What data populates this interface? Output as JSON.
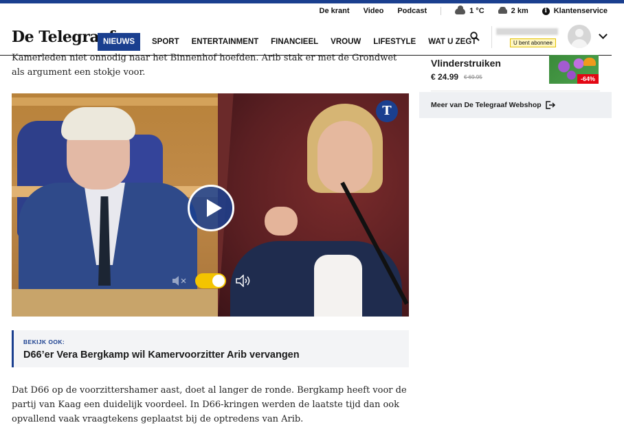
{
  "utility": {
    "de_krant": "De krant",
    "video": "Video",
    "podcast": "Podcast",
    "weather": "1 °C",
    "traffic": "2 km",
    "service": "Klantenservice"
  },
  "brand": {
    "logo": "De Telegraaf"
  },
  "nav": {
    "items": [
      "NIEUWS",
      "SPORT",
      "ENTERTAINMENT",
      "FINANCIEEL",
      "VROUW",
      "LIFESTYLE",
      "WAT U ZEGT"
    ],
    "active": "NIEUWS"
  },
  "user": {
    "subscriber_label": "U bent abonnee"
  },
  "article": {
    "intro": "Kamerleden niet onnodig naar het Binnenhof hoefden. Arib stak er met de Grondwet als argument een stokje voor.",
    "video_logo": "T",
    "read_also": {
      "label": "BEKIJK OOK:",
      "title": "D66’er Vera Bergkamp wil Kamervoorzitter Arib vervangen"
    },
    "body": "Dat D66 op de voorzittershamer aast, doet al langer de ronde. Bergkamp heeft voor de partij van Kaag een duidelijk voordeel. In D66-kringen werden de laatste tijd dan ook opvallend vaak vraagtekens geplaatst bij de optredens van Arib."
  },
  "sidebar": {
    "shop_item": {
      "name": "Vlinderstruiken",
      "price": "€ 24.99",
      "old_price": "€ 69.95",
      "discount": "-64%"
    },
    "more_link": "Meer van De Telegraaf Webshop"
  },
  "colors": {
    "brand_blue": "#1a3f8f",
    "toggle_yellow": "#f4c400",
    "discount_red": "#e30613"
  }
}
